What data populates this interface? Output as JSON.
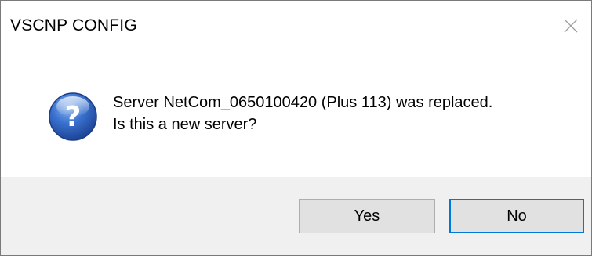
{
  "window": {
    "title": "VSCNP CONFIG",
    "close_icon": "close-icon"
  },
  "message": {
    "icon": "question-icon",
    "line1": "Server NetCom_0650100420 (Plus 113) was replaced.",
    "line2": "Is this a new server?"
  },
  "buttons": {
    "yes_label": "Yes",
    "no_label": "No",
    "default": "No"
  },
  "colors": {
    "focus_border": "#0078d7",
    "footer_bg": "#f0f0f0",
    "button_bg": "#e1e1e1",
    "icon_blue": "#2a63c4"
  }
}
